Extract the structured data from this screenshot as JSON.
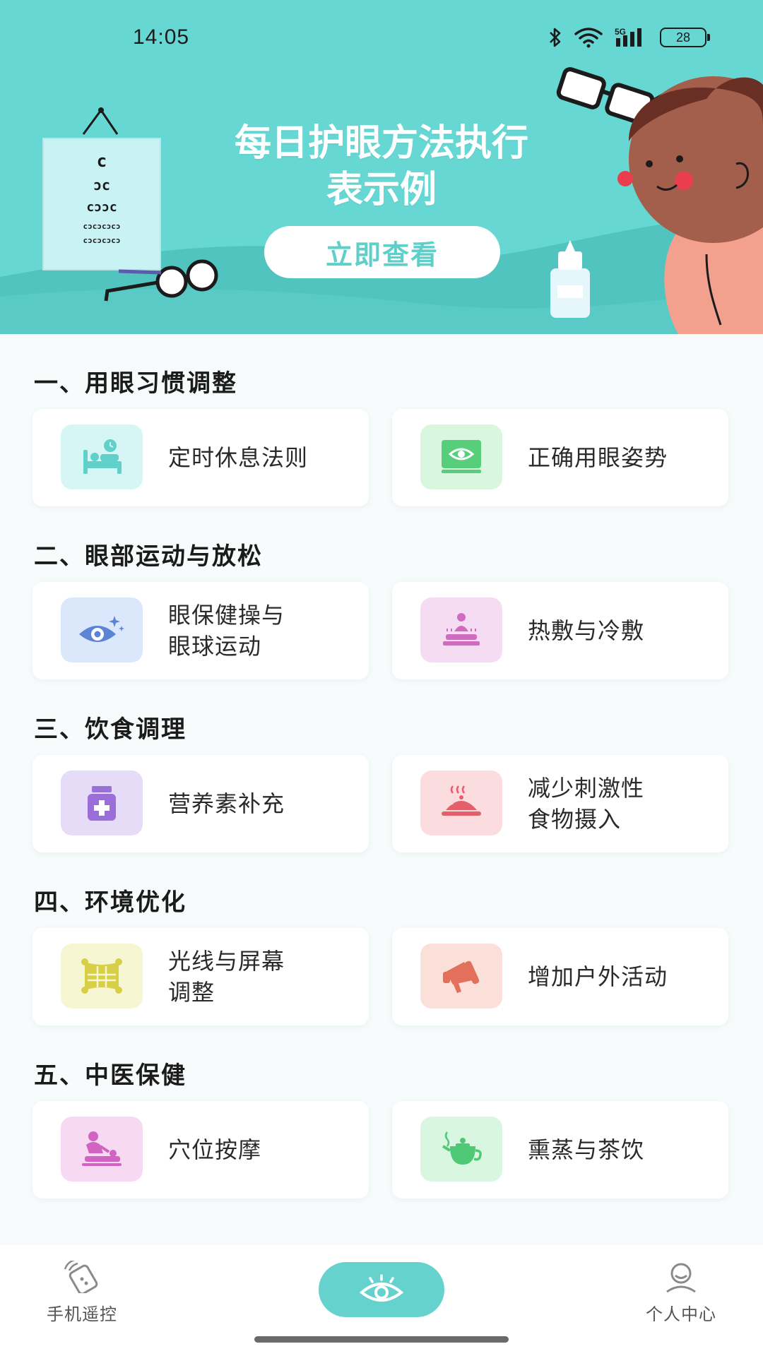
{
  "status_bar": {
    "time": "14:05",
    "battery": "28",
    "icons": [
      "bluetooth-icon",
      "wifi-icon",
      "5g-signal-icon",
      "battery-icon"
    ]
  },
  "banner": {
    "title_line1": "每日护眼方法执行",
    "title_line2": "表示例",
    "button_label": "立即查看",
    "eye_chart_rows": [
      "c",
      "ɔc",
      "cɔɔc",
      "cɔcɔcɔcɔ",
      "cɔcɔcɔcɔ"
    ],
    "colors": {
      "background": "#66d7d3",
      "wave": "#52c4c0",
      "button_text": "#5fcfca"
    }
  },
  "sections": [
    {
      "title": "一、用眼习惯调整",
      "items": [
        {
          "label": "定时休息法则",
          "icon": "bed-clock-icon",
          "icon_bg": "#d5f6f4",
          "icon_color": "#5fd0ca"
        },
        {
          "label": "正确用眼姿势",
          "icon": "eye-monitor-icon",
          "icon_bg": "#d9f7df",
          "icon_color": "#57cf7a"
        }
      ]
    },
    {
      "title": "二、眼部运动与放松",
      "items": [
        {
          "label": "眼保健操与眼球运动",
          "label_line1": "眼保健操与",
          "label_line2": "眼球运动",
          "icon": "sparkle-eye-icon",
          "icon_bg": "#dbe7fb",
          "icon_color": "#5b83d6"
        },
        {
          "label": "热敷与冷敷",
          "icon": "spa-treatment-icon",
          "icon_bg": "#f6dcf3",
          "icon_color": "#d16bc1"
        }
      ]
    },
    {
      "title": "三、饮食调理",
      "items": [
        {
          "label": "营养素补充",
          "icon": "medicine-bottle-icon",
          "icon_bg": "#e6dcf7",
          "icon_color": "#9b6fd9"
        },
        {
          "label": "减少刺激性食物摄入",
          "label_line1": "减少刺激性",
          "label_line2": "食物摄入",
          "icon": "hot-dish-icon",
          "icon_bg": "#fbdde0",
          "icon_color": "#e3606b"
        }
      ]
    },
    {
      "title": "四、环境优化",
      "items": [
        {
          "label": "光线与屏幕调整",
          "label_line1": "光线与屏幕",
          "label_line2": "调整",
          "icon": "window-frame-icon",
          "icon_bg": "#f7f6d3",
          "icon_color": "#d7cf45"
        },
        {
          "label": "增加户外活动",
          "icon": "megaphone-icon",
          "icon_bg": "#fbe0d9",
          "icon_color": "#e2705b"
        }
      ]
    },
    {
      "title": "五、中医保健",
      "items": [
        {
          "label": "穴位按摩",
          "icon": "massage-icon",
          "icon_bg": "#f7d9f2",
          "icon_color": "#d163c2"
        },
        {
          "label": "熏蒸与茶饮",
          "icon": "teapot-icon",
          "icon_bg": "#d9f7e0",
          "icon_color": "#4fc975"
        }
      ]
    }
  ],
  "bottom_nav": {
    "left_label": "手机遥控",
    "left_icon": "remote-control-icon",
    "center_icon": "eye-icon",
    "right_label": "个人中心",
    "right_icon": "user-icon",
    "accent": "#66d2cd"
  }
}
